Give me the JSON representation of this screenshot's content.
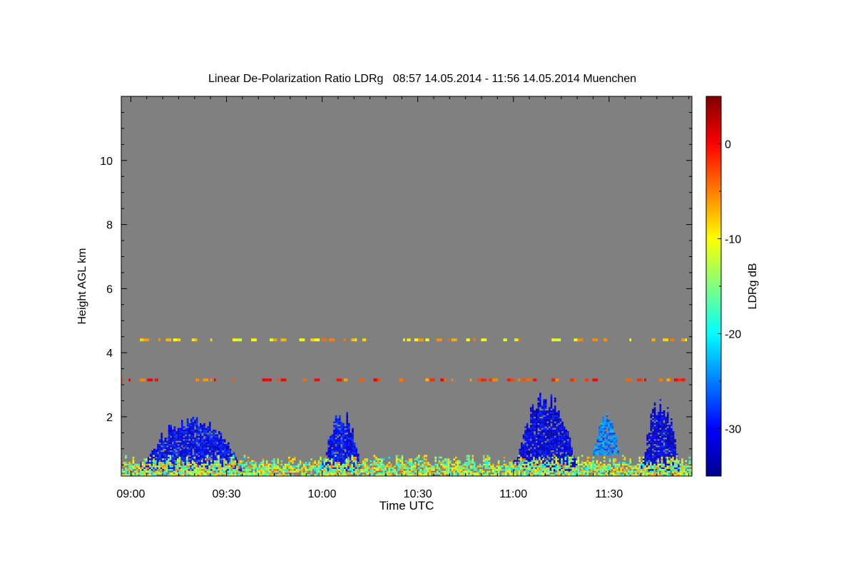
{
  "chart_data": {
    "type": "heatmap",
    "title": "Linear De-Polarization Ratio LDRg   08:57 14.05.2014 - 11:56 14.05.2014 Muenchen",
    "xlabel": "Time UTC",
    "ylabel": "Height AGL km",
    "colorbar_label": "LDRg dB",
    "x_range": [
      "08:57",
      "11:56"
    ],
    "ylim": [
      0.15,
      12.0
    ],
    "x_ticks": [
      "09:00",
      "09:30",
      "10:00",
      "10:30",
      "11:00",
      "11:30"
    ],
    "y_ticks": [
      2,
      4,
      6,
      8,
      10
    ],
    "colorbar_range": [
      -35,
      5
    ],
    "colorbar_ticks": [
      0,
      -10,
      -20,
      -30
    ],
    "colormap": "jet",
    "background_no_signal_color": "#808080",
    "features": [
      {
        "kind": "cloud",
        "start": "09:03",
        "end": "09:35",
        "base_km": 0.3,
        "top_km": 2.2,
        "ldr_db": -30
      },
      {
        "kind": "cloud",
        "start": "10:00",
        "end": "10:12",
        "base_km": 0.3,
        "top_km": 2.3,
        "ldr_db": -30
      },
      {
        "kind": "cloud",
        "start": "11:00",
        "end": "11:20",
        "base_km": 0.3,
        "top_km": 2.9,
        "ldr_db": -31
      },
      {
        "kind": "cloud",
        "start": "11:40",
        "end": "11:52",
        "base_km": 0.3,
        "top_km": 2.7,
        "ldr_db": -31
      },
      {
        "kind": "cloud",
        "start": "11:25",
        "end": "11:33",
        "base_km": 0.8,
        "top_km": 2.2,
        "ldr_db": -25
      },
      {
        "kind": "boundary_layer",
        "start": "08:57",
        "end": "11:56",
        "base_km": 0.15,
        "top_km": 0.8,
        "ldr_db": -15
      },
      {
        "kind": "speckle_line",
        "start": "08:57",
        "end": "11:56",
        "height_km": 4.4,
        "ldr_db": -8
      },
      {
        "kind": "speckle_line",
        "start": "08:57",
        "end": "11:56",
        "height_km": 3.15,
        "ldr_db": -3
      }
    ]
  }
}
